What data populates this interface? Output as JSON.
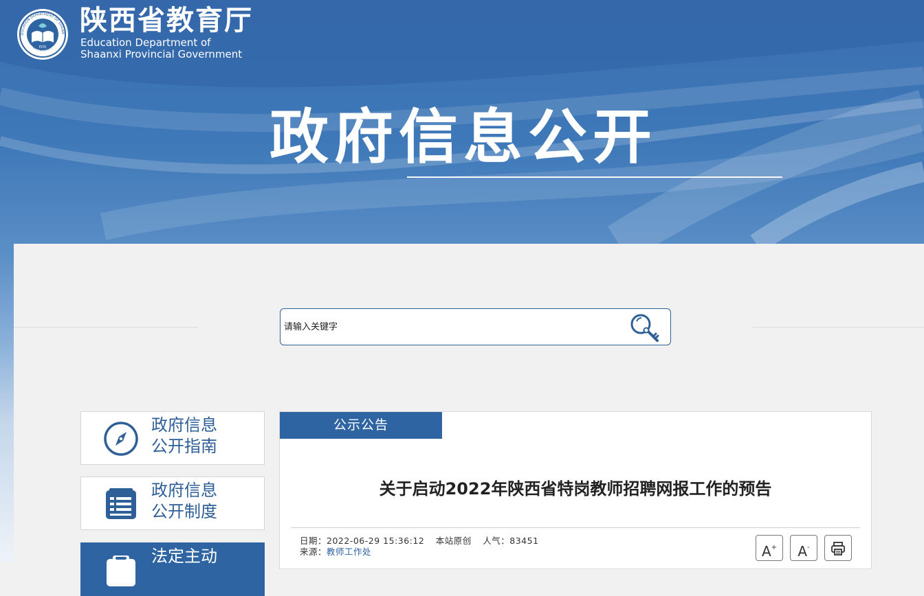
{
  "header": {
    "org_name_cn": "陕西省教育厅",
    "org_name_en_line1": "Education Department of",
    "org_name_en_line2": "Shaanxi Provincial Government",
    "logo": {
      "icon": "book-emblem-icon",
      "ring_text": "EDUCATION DEPARTMENT OF SHAANXI",
      "bottom_text": "陕西省教育厅",
      "center_text": "EDS"
    },
    "hero_title": "政府信息公开"
  },
  "search": {
    "placeholder": "请输入关键字",
    "icon": "magnifier-key-icon"
  },
  "sidebar": {
    "items": [
      {
        "line1": "政府信息",
        "line2": "公开指南",
        "icon": "compass-icon",
        "active": false
      },
      {
        "line1": "政府信息",
        "line2": "公开制度",
        "icon": "document-list-icon",
        "active": false
      },
      {
        "line1": "法定主动",
        "line2": "",
        "icon": "clipboard-icon",
        "active": true
      }
    ]
  },
  "article": {
    "tab_label": "公示公告",
    "title": "关于启动2022年陕西省特岗教师招聘网报工作的预告",
    "meta": {
      "date_label": "日期：",
      "date_value": "2022-06-29 15:36:12",
      "origin": "本站原创",
      "views_label": "人气：",
      "views_value": "83451",
      "source_label": "来源：",
      "source_value": "教师工作处"
    },
    "tools": {
      "font_increase_label": "A",
      "font_increase_sup": "+",
      "font_decrease_label": "A",
      "font_decrease_sup": "-",
      "print_icon": "printer-icon"
    }
  },
  "colors": {
    "primary": "#2e64a1",
    "banner_top": "#3a6fb0",
    "page_bg": "#f1f1f1"
  }
}
